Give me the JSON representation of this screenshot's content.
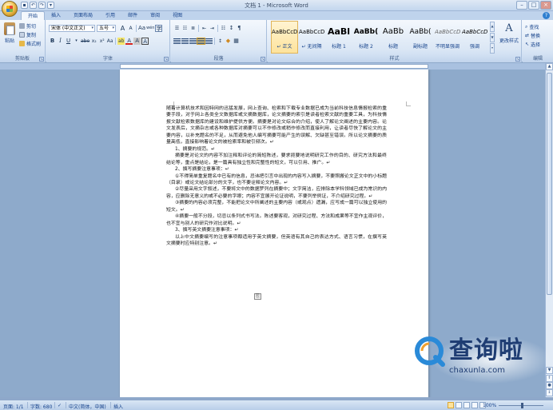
{
  "window": {
    "title": "文档 1 - Microsoft Word",
    "minimize": "–",
    "maximize": "□",
    "close": "×"
  },
  "qat": {
    "save": "▪",
    "undo": "↶",
    "redo": "↷",
    "more": "▾"
  },
  "tabs": [
    "开始",
    "插入",
    "页面布局",
    "引用",
    "邮件",
    "审阅",
    "视图"
  ],
  "help": "?",
  "ribbon": {
    "clipboard": {
      "paste": "粘贴",
      "cut": "剪切",
      "copy": "复制",
      "format_painter": "格式刷",
      "label": "剪贴板"
    },
    "font": {
      "name": "宋体 (中文正文)",
      "size": "五号",
      "grow": "A",
      "shrink": "A",
      "clear": "Aa",
      "phonetic": "wén",
      "enclose": "字",
      "bold": "B",
      "italic": "I",
      "underline": "U",
      "strike": "abe",
      "subscript": "x₂",
      "superscript": "x²",
      "case": "Aa",
      "highlight": "ab",
      "color": "A",
      "shade": "A",
      "border": "A",
      "label": "字体"
    },
    "paragraph": {
      "sort": "↕",
      "marks": "¶",
      "asian": "☷",
      "shading": "◆",
      "borders": "▦",
      "label": "段落"
    },
    "styles": {
      "items": [
        {
          "sample": "AaBbCcDd",
          "name": "↵ 正文"
        },
        {
          "sample": "AaBbCcDd",
          "name": "↵ 无间隔"
        },
        {
          "sample": "AaBl",
          "name": "标题 1"
        },
        {
          "sample": "AaBb(",
          "name": "标题 2"
        },
        {
          "sample": "AaBb",
          "name": "标题"
        },
        {
          "sample": "AaBb(",
          "name": "副标题"
        },
        {
          "sample": "AaBbCcD",
          "name": "不明显强调"
        },
        {
          "sample": "AaBbCcD",
          "name": "强调"
        }
      ],
      "change": "更改样式",
      "label": "样式"
    },
    "editing": {
      "find": "查找",
      "replace": "替换",
      "select": "选择",
      "label": "编辑"
    }
  },
  "document": {
    "paragraphs": [
      "随着计算机技术和因特网的迅猛发展，网上查询、检索和下载专业数据已成为当前科技信息情报检索的重要手段，对于网上各类全文数据库或文摘数据库，论文摘要的索引是读者检索文献的重要工具，为科技情报文献检索数据库的建设和维护提供方便。摘要是对论文综合的介绍，使人了解论文阐述的主要内容。论文发表后，文摘杂志或各种数据库对摘要可以不作修改或稍作修改而直接利用，让读者尽快了解论文的主要内容，以补充题名的不足，从而避免他人编写摘要可能产生的误解、欠缺甚至错误。所以论文摘要的质量高低，直接影响着论文的被检索率和被引频次。↵",
      "1、摘要的规范。↵",
      "摘要是对论文的内容不加注释和评论的简短陈述，要求扼要地说明研究工作的目的、研究方法和最终结论等，重点是结论，是一篇具有独立性和完整性的短文，可以引用、推广。↵",
      "2、撰写摘要注意事项：↵",
      "①不得简单重复题名中已有的信息，忌讳把引言中出现的内容写入摘要，不要照搬论文正文中的小标题（目录）或论文结论部分的文字，也不要诠释论文内容。↵",
      "②尽量采用文字叙述，不要将文中的数据罗列在摘要中；文字简洁，应排除本学科领域已成为常识的内容，应删除无意义的或不必要的字眼；内容不宜展开论证说明，不要列举例证，不介绍研究过程。↵",
      "③摘要的内容必须完整，不能把论文中所阐述的主要内容（或观点）遗漏，应写成一篇可以独立使用的短文。↵",
      "④摘要一般不分段，切忌以条列式书写法。陈述要客观，对研究过程、方法和成果等不宜作主观评价，也不宜与别人的研究作对比说明。↵",
      "3、撰写英文摘要注意事项：↵",
      "以上中文摘要编写的注意事项都适用于英文摘要，但英语有其自己的表达方式、语言习惯，在撰写英文摘要时应特别注意。↵"
    ],
    "paste_options": "⎘"
  },
  "statusbar": {
    "page": "页面: 1/1",
    "words": "字数: 680",
    "check": "✓",
    "lang": "中文(简体，中国)",
    "mode": "插入",
    "zoom": "100%",
    "zoom_minus": "−",
    "zoom_plus": "+"
  },
  "watermark": {
    "brand": "查询啦",
    "url": "chaxunla.com"
  },
  "colors": {
    "ribbon_text": "#15428b",
    "doc_bg": "#8eaacb",
    "highlight": "#f7d67a",
    "watermark_blue": "#2a8ad8",
    "watermark_orange": "#f0a030"
  }
}
